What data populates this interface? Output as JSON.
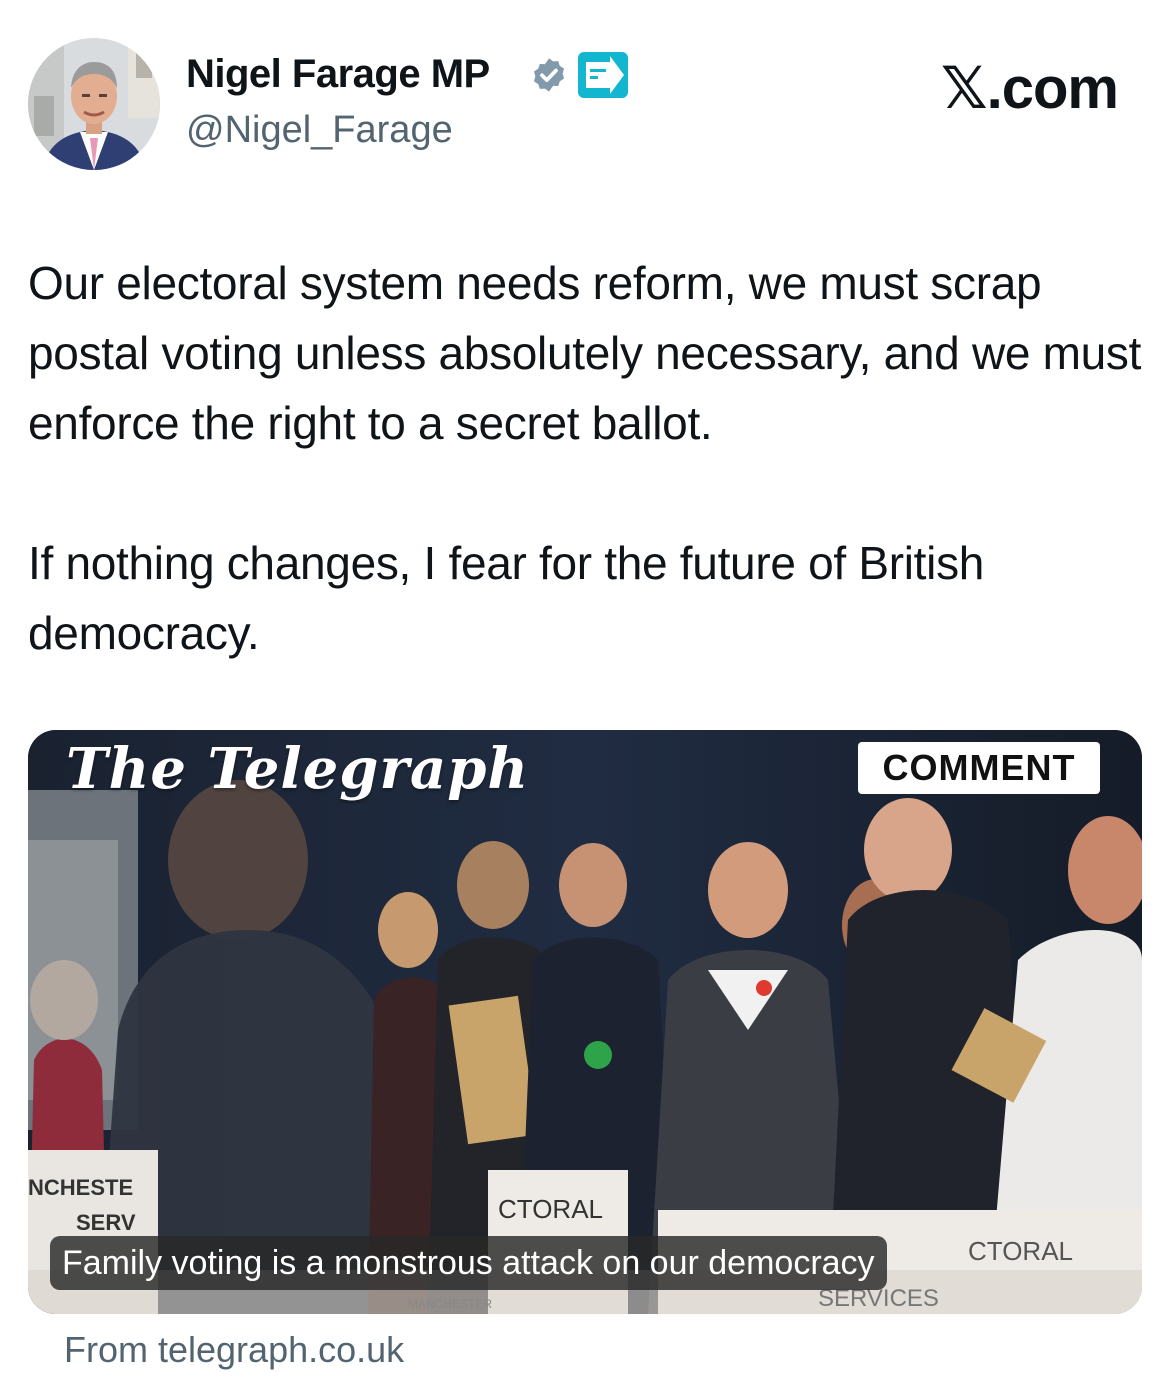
{
  "author": {
    "display_name": "Nigel Farage MP",
    "handle": "@Nigel_Farage",
    "party_badge_text": "REFORM UK",
    "avatar_icon": "profile-photo-avatar"
  },
  "brand": {
    "label": "𝕏.com"
  },
  "tweet": {
    "paragraphs": [
      "Our electoral system needs reform, we must scrap postal voting unless absolutely necessary, and we must enforce the right to a secret ballot.",
      "If nothing changes, I fear for the future of British democracy."
    ]
  },
  "link_card": {
    "publisher_logo": "The Telegraph",
    "section_badge": "COMMENT",
    "headline": "Family voting is a monstrous attack on our democracy",
    "source": "From telegraph.co.uk",
    "photo_signs": [
      "NCHESTE",
      "SERV",
      "CTORAL",
      "CTORAL",
      "SERVICES",
      "MANCHESTER"
    ]
  },
  "colors": {
    "verified": "#829aab",
    "party_badge": "#12b6cf",
    "secondary_text": "#536471"
  }
}
